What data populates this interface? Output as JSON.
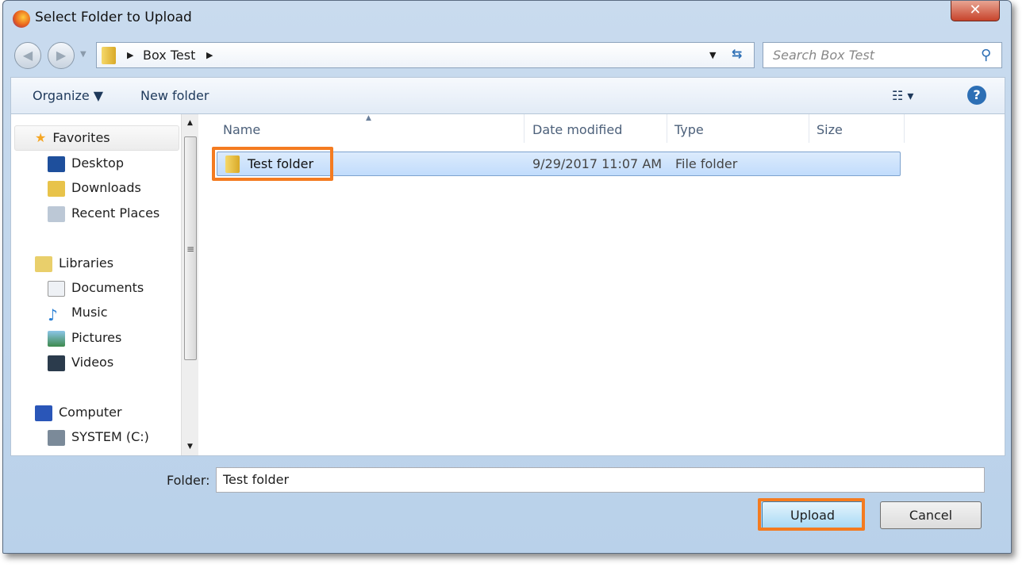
{
  "window": {
    "title": "Select Folder to Upload",
    "close_label": "✕"
  },
  "address": {
    "path": "Box Test",
    "search_placeholder": "Search Box Test"
  },
  "toolbar": {
    "organize": "Organize ▼",
    "new_folder": "New folder",
    "help": "?"
  },
  "sidebar": {
    "groups": [
      {
        "label": "Favorites",
        "items": [
          "Desktop",
          "Downloads",
          "Recent Places"
        ]
      },
      {
        "label": "Libraries",
        "items": [
          "Documents",
          "Music",
          "Pictures",
          "Videos"
        ]
      },
      {
        "label": "Computer",
        "items": [
          "SYSTEM (C:)"
        ]
      }
    ]
  },
  "columns": [
    "Name",
    "Date modified",
    "Type",
    "Size"
  ],
  "files": [
    {
      "name": "Test folder",
      "date": "9/29/2017 11:07 AM",
      "type": "File folder",
      "size": ""
    }
  ],
  "footer": {
    "folder_label": "Folder:",
    "folder_value": "Test folder",
    "upload": "Upload",
    "cancel": "Cancel"
  },
  "colors": {
    "highlight": "#f47b20",
    "selection": "#c1dcfc"
  }
}
